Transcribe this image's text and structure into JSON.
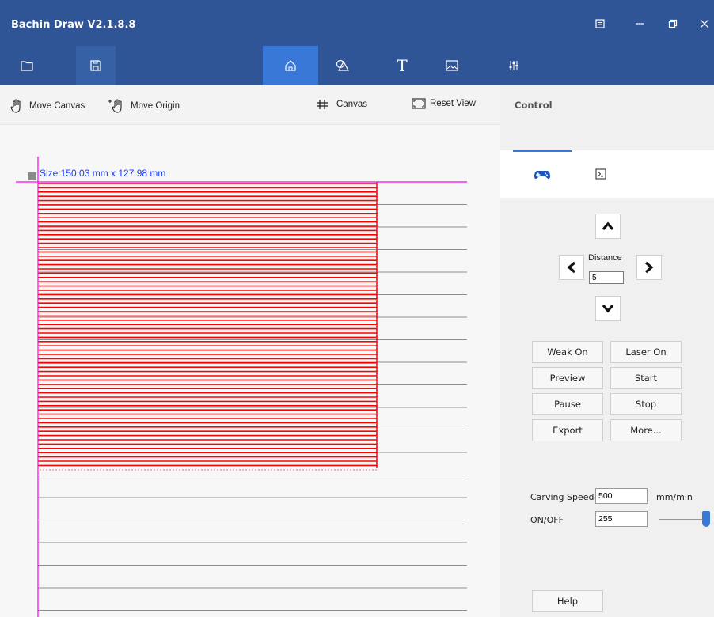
{
  "window": {
    "title": "Bachin Draw V2.1.8.8",
    "controls": [
      "menu-icon",
      "minimize-icon",
      "restore-icon",
      "close-icon"
    ]
  },
  "toolbar": {
    "items": [
      {
        "name": "open-folder",
        "icon": "folder-icon"
      },
      {
        "name": "save",
        "icon": "save-icon"
      },
      {
        "name": "home",
        "icon": "home-icon",
        "active": true
      },
      {
        "name": "shapes",
        "icon": "shapes-icon"
      },
      {
        "name": "text",
        "icon": "text-icon"
      },
      {
        "name": "image",
        "icon": "image-icon"
      },
      {
        "name": "settings",
        "icon": "sliders-icon"
      }
    ],
    "text_glyph": "T"
  },
  "subtoolbar": {
    "move_canvas": "Move Canvas",
    "move_origin": "Move Origin",
    "canvas": "Canvas",
    "reset_view": "Reset View"
  },
  "canvas": {
    "size_label": "Size:150.03 mm x 127.98 mm",
    "line_color": "#ff0000",
    "origin_color": "#ff00ff"
  },
  "panel": {
    "header": "Control",
    "tabs": [
      {
        "icon": "gamepad-icon",
        "active": true
      },
      {
        "icon": "terminal-icon",
        "active": false
      }
    ],
    "distance_label": "Distance",
    "distance_value": "5",
    "buttons": [
      [
        "Weak On",
        "Laser On"
      ],
      [
        "Preview",
        "Start"
      ],
      [
        "Pause",
        "Stop"
      ],
      [
        "Export",
        "More..."
      ]
    ],
    "carving_speed_label": "Carving Speed",
    "carving_speed_value": "500",
    "carving_speed_unit": "mm/min",
    "onoff_label": "ON/OFF",
    "onoff_value": "255",
    "onoff_slider_level": 1.0,
    "help": "Help"
  },
  "colors": {
    "titlebar": "#2f5597",
    "accent": "#3a78d8"
  }
}
